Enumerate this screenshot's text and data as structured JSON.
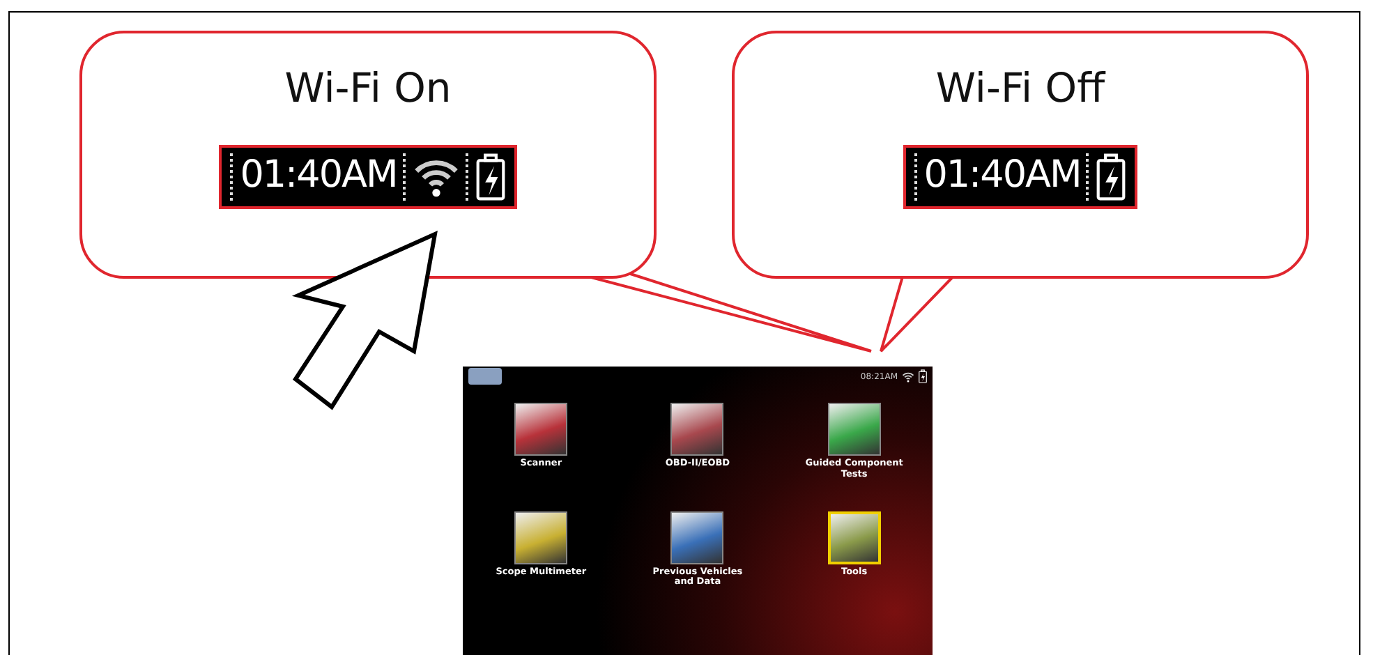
{
  "callouts": [
    {
      "title": "Wi-Fi On",
      "time": "01:40AM",
      "wifi": true
    },
    {
      "title": "Wi-Fi Off",
      "time": "01:40AM",
      "wifi": false
    }
  ],
  "device_screen": {
    "status_time": "08:21AM",
    "wifi": true,
    "tiles": [
      {
        "label": "Scanner",
        "color": "#b8323a",
        "selected": false
      },
      {
        "label": "OBD-II/EOBD",
        "color": "#a8484e",
        "selected": false
      },
      {
        "label": "Guided Component Tests",
        "color": "#3aa84a",
        "selected": false
      },
      {
        "label": "Scope Multimeter",
        "color": "#c8b032",
        "selected": false
      },
      {
        "label": "Previous Vehicles and Data",
        "color": "#3a70b8",
        "selected": false
      },
      {
        "label": "Tools",
        "color": "#8a9a4a",
        "selected": true
      }
    ]
  }
}
